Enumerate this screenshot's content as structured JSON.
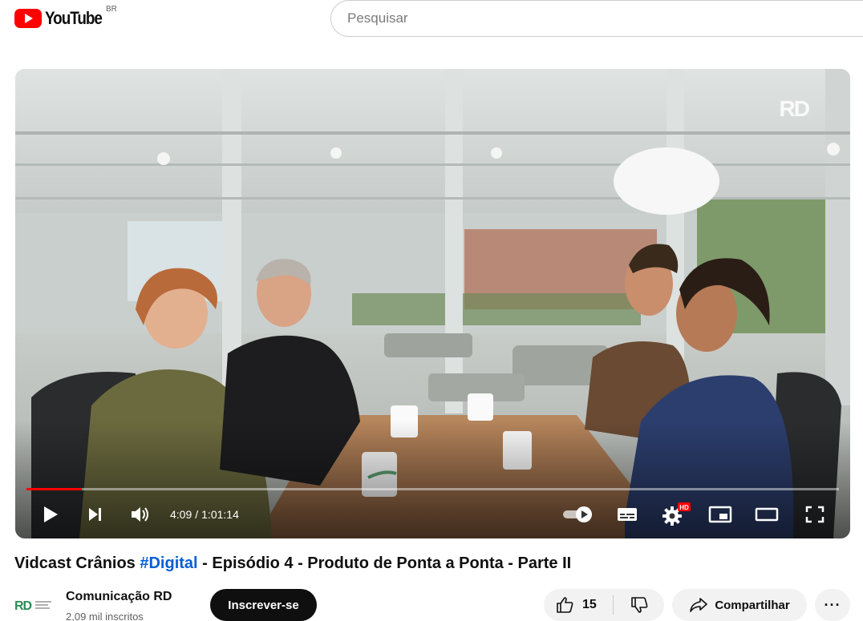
{
  "header": {
    "logo_text": "YouTube",
    "country_code": "BR",
    "search_placeholder": "Pesquisar"
  },
  "player": {
    "current_time": "4:09",
    "separator": "/",
    "duration": "1:01:14",
    "progress_fraction": 0.068,
    "watermark": "RD",
    "hd_badge": "HD",
    "controls": [
      "play-icon",
      "next-icon",
      "volume-icon",
      "autoplay-toggle-icon",
      "subtitles-icon",
      "settings-icon",
      "miniplayer-icon",
      "theater-icon",
      "fullscreen-icon"
    ]
  },
  "video": {
    "title_before": "Vidcast Crânios ",
    "title_hashtag": "#Digital",
    "title_after": " - Episódio 4 - Produto de Ponta a Ponta - Parte II"
  },
  "channel": {
    "name": "Comunicação RD",
    "subscribers": "2,09 mil inscritos",
    "logo_text": "RD"
  },
  "actions": {
    "subscribe_label": "Inscrever-se",
    "likes": "15",
    "share_label": "Compartilhar",
    "more_label": "···"
  },
  "colors": {
    "brand_red": "#ff0000",
    "hashtag_blue": "#065fd4",
    "rd_green": "#2e8b57"
  }
}
